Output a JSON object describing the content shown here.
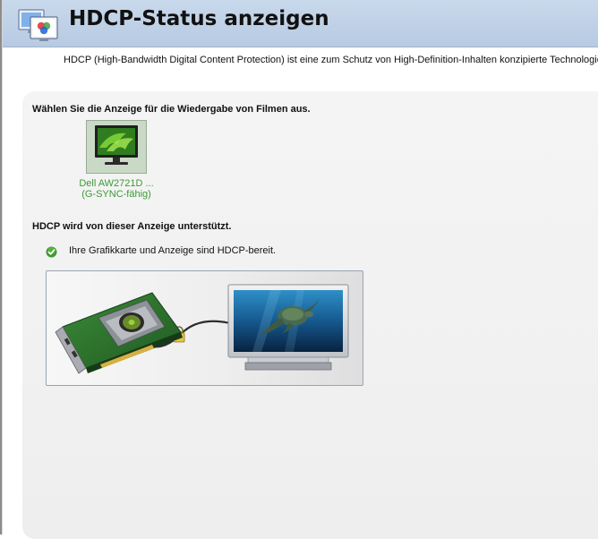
{
  "header": {
    "title": "HDCP-Status anzeigen",
    "icon": "display-settings-icon"
  },
  "description": "HDCP (High-Bandwidth Digital Content Protection) ist eine zum Schutz von High-Definition-Inhalten konzipierte Technologie. Au",
  "display_section": {
    "heading": "Wählen Sie die Anzeige für die Wiedergabe von Filmen aus.",
    "display": {
      "name": "Dell AW2721D ...",
      "subtitle": "(G-SYNC-fähig)",
      "icon": "nvidia-monitor-icon"
    }
  },
  "hdcp_section": {
    "heading": "HDCP wird von dieser Anzeige unterstützt.",
    "status_text": "Ihre Grafikkarte und Anzeige sind HDCP-bereit.",
    "status_icon": "green-check-icon"
  },
  "colors": {
    "header_bg": "#c0d3e9",
    "nvidia_green": "#3c9a36",
    "panel_bg": "#f2f2f2"
  }
}
